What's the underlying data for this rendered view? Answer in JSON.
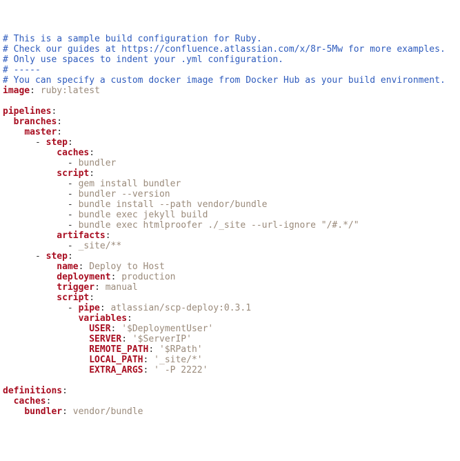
{
  "lines": [
    [
      {
        "c": "c",
        "t": "# This is a sample build configuration for Ruby."
      }
    ],
    [
      {
        "c": "c",
        "t": "# Check our guides at https://confluence.atlassian.com/x/8r-5Mw for more examples."
      }
    ],
    [
      {
        "c": "c",
        "t": "# Only use spaces to indent your .yml configuration."
      }
    ],
    [
      {
        "c": "c",
        "t": "# -----"
      }
    ],
    [
      {
        "c": "c",
        "t": "# You can specify a custom docker image from Docker Hub as your build environment."
      }
    ],
    [
      {
        "c": "k",
        "t": "image"
      },
      {
        "c": "p",
        "t": ": "
      },
      {
        "c": "s",
        "t": "ruby:latest"
      }
    ],
    [
      {
        "c": "p",
        "t": ""
      }
    ],
    [
      {
        "c": "k",
        "t": "pipelines"
      },
      {
        "c": "p",
        "t": ":"
      }
    ],
    [
      {
        "c": "p",
        "t": "  "
      },
      {
        "c": "k",
        "t": "branches"
      },
      {
        "c": "p",
        "t": ":"
      }
    ],
    [
      {
        "c": "p",
        "t": "    "
      },
      {
        "c": "k",
        "t": "master"
      },
      {
        "c": "p",
        "t": ":"
      }
    ],
    [
      {
        "c": "p",
        "t": "      - "
      },
      {
        "c": "k",
        "t": "step"
      },
      {
        "c": "p",
        "t": ":"
      }
    ],
    [
      {
        "c": "p",
        "t": "          "
      },
      {
        "c": "k",
        "t": "caches"
      },
      {
        "c": "p",
        "t": ":"
      }
    ],
    [
      {
        "c": "p",
        "t": "            - "
      },
      {
        "c": "s",
        "t": "bundler"
      }
    ],
    [
      {
        "c": "p",
        "t": "          "
      },
      {
        "c": "k",
        "t": "script"
      },
      {
        "c": "p",
        "t": ":"
      }
    ],
    [
      {
        "c": "p",
        "t": "            - "
      },
      {
        "c": "s",
        "t": "gem install bundler"
      }
    ],
    [
      {
        "c": "p",
        "t": "            - "
      },
      {
        "c": "s",
        "t": "bundler --version"
      }
    ],
    [
      {
        "c": "p",
        "t": "            - "
      },
      {
        "c": "s",
        "t": "bundle install --path vendor/bundle"
      }
    ],
    [
      {
        "c": "p",
        "t": "            - "
      },
      {
        "c": "s",
        "t": "bundle exec jekyll build"
      }
    ],
    [
      {
        "c": "p",
        "t": "            - "
      },
      {
        "c": "s",
        "t": "bundle exec htmlproofer ./_site --url-ignore \"/#.*/\""
      }
    ],
    [
      {
        "c": "p",
        "t": "          "
      },
      {
        "c": "k",
        "t": "artifacts"
      },
      {
        "c": "p",
        "t": ":"
      }
    ],
    [
      {
        "c": "p",
        "t": "            - "
      },
      {
        "c": "s",
        "t": "_site/**"
      }
    ],
    [
      {
        "c": "p",
        "t": "      - "
      },
      {
        "c": "k",
        "t": "step"
      },
      {
        "c": "p",
        "t": ":"
      }
    ],
    [
      {
        "c": "p",
        "t": "          "
      },
      {
        "c": "k",
        "t": "name"
      },
      {
        "c": "p",
        "t": ": "
      },
      {
        "c": "s",
        "t": "Deploy to Host"
      }
    ],
    [
      {
        "c": "p",
        "t": "          "
      },
      {
        "c": "k",
        "t": "deployment"
      },
      {
        "c": "p",
        "t": ": "
      },
      {
        "c": "s",
        "t": "production"
      }
    ],
    [
      {
        "c": "p",
        "t": "          "
      },
      {
        "c": "k",
        "t": "trigger"
      },
      {
        "c": "p",
        "t": ": "
      },
      {
        "c": "s",
        "t": "manual"
      }
    ],
    [
      {
        "c": "p",
        "t": "          "
      },
      {
        "c": "k",
        "t": "script"
      },
      {
        "c": "p",
        "t": ":"
      }
    ],
    [
      {
        "c": "p",
        "t": "            - "
      },
      {
        "c": "k",
        "t": "pipe"
      },
      {
        "c": "p",
        "t": ": "
      },
      {
        "c": "s",
        "t": "atlassian/scp-deploy:0.3.1"
      }
    ],
    [
      {
        "c": "p",
        "t": "              "
      },
      {
        "c": "k",
        "t": "variables"
      },
      {
        "c": "p",
        "t": ":"
      }
    ],
    [
      {
        "c": "p",
        "t": "                "
      },
      {
        "c": "k",
        "t": "USER"
      },
      {
        "c": "p",
        "t": ": "
      },
      {
        "c": "q",
        "t": "'$DeploymentUser'"
      }
    ],
    [
      {
        "c": "p",
        "t": "                "
      },
      {
        "c": "k",
        "t": "SERVER"
      },
      {
        "c": "p",
        "t": ": "
      },
      {
        "c": "q",
        "t": "'$ServerIP'"
      }
    ],
    [
      {
        "c": "p",
        "t": "                "
      },
      {
        "c": "k",
        "t": "REMOTE_PATH"
      },
      {
        "c": "p",
        "t": ": "
      },
      {
        "c": "q",
        "t": "'$RPath'"
      }
    ],
    [
      {
        "c": "p",
        "t": "                "
      },
      {
        "c": "k",
        "t": "LOCAL_PATH"
      },
      {
        "c": "p",
        "t": ": "
      },
      {
        "c": "q",
        "t": "'_site/*'"
      }
    ],
    [
      {
        "c": "p",
        "t": "                "
      },
      {
        "c": "k",
        "t": "EXTRA_ARGS"
      },
      {
        "c": "p",
        "t": ": "
      },
      {
        "c": "q",
        "t": "' -P 2222'"
      }
    ],
    [
      {
        "c": "p",
        "t": ""
      }
    ],
    [
      {
        "c": "k",
        "t": "definitions"
      },
      {
        "c": "p",
        "t": ":"
      }
    ],
    [
      {
        "c": "p",
        "t": "  "
      },
      {
        "c": "k",
        "t": "caches"
      },
      {
        "c": "p",
        "t": ":"
      }
    ],
    [
      {
        "c": "p",
        "t": "    "
      },
      {
        "c": "k",
        "t": "bundler"
      },
      {
        "c": "p",
        "t": ": "
      },
      {
        "c": "s",
        "t": "vendor/bundle"
      }
    ]
  ]
}
